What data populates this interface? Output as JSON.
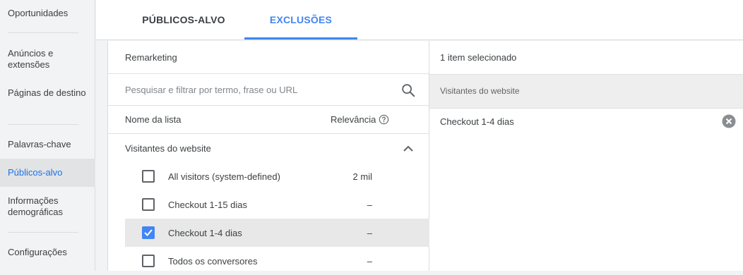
{
  "sidebar": {
    "items": [
      {
        "label": "Oportunidades"
      },
      {
        "label": "Anúncios e extensões"
      },
      {
        "label": "Páginas de destino"
      },
      {
        "label": "Palavras-chave"
      },
      {
        "label": "Públicos-alvo"
      },
      {
        "label": "Informações demográficas"
      },
      {
        "label": "Configurações"
      }
    ],
    "active": "Públicos-alvo"
  },
  "tabs": [
    {
      "label": "PÚBLICOS-ALVO"
    },
    {
      "label": "EXCLUSÕES"
    }
  ],
  "active_tab": "EXCLUSÕES",
  "left_panel": {
    "header": "Remarketing",
    "search_placeholder": "Pesquisar e filtrar por termo, frase ou URL",
    "col_name": "Nome da lista",
    "col_relevance": "Relevância",
    "group": "Visitantes do website",
    "rows": [
      {
        "label": "All visitors (system-defined)",
        "relevance": "2 mil",
        "checked": false
      },
      {
        "label": "Checkout 1-15 dias",
        "relevance": "–",
        "checked": false
      },
      {
        "label": "Checkout 1-4 dias",
        "relevance": "–",
        "checked": true
      },
      {
        "label": "Todos os conversores",
        "relevance": "–",
        "checked": false
      }
    ]
  },
  "right_panel": {
    "header": "1 item selecionado",
    "group": "Visitantes do website",
    "item": "Checkout 1-4 dias"
  },
  "colors": {
    "accent": "#4285f4",
    "active_nav_text": "#1a73e8"
  }
}
